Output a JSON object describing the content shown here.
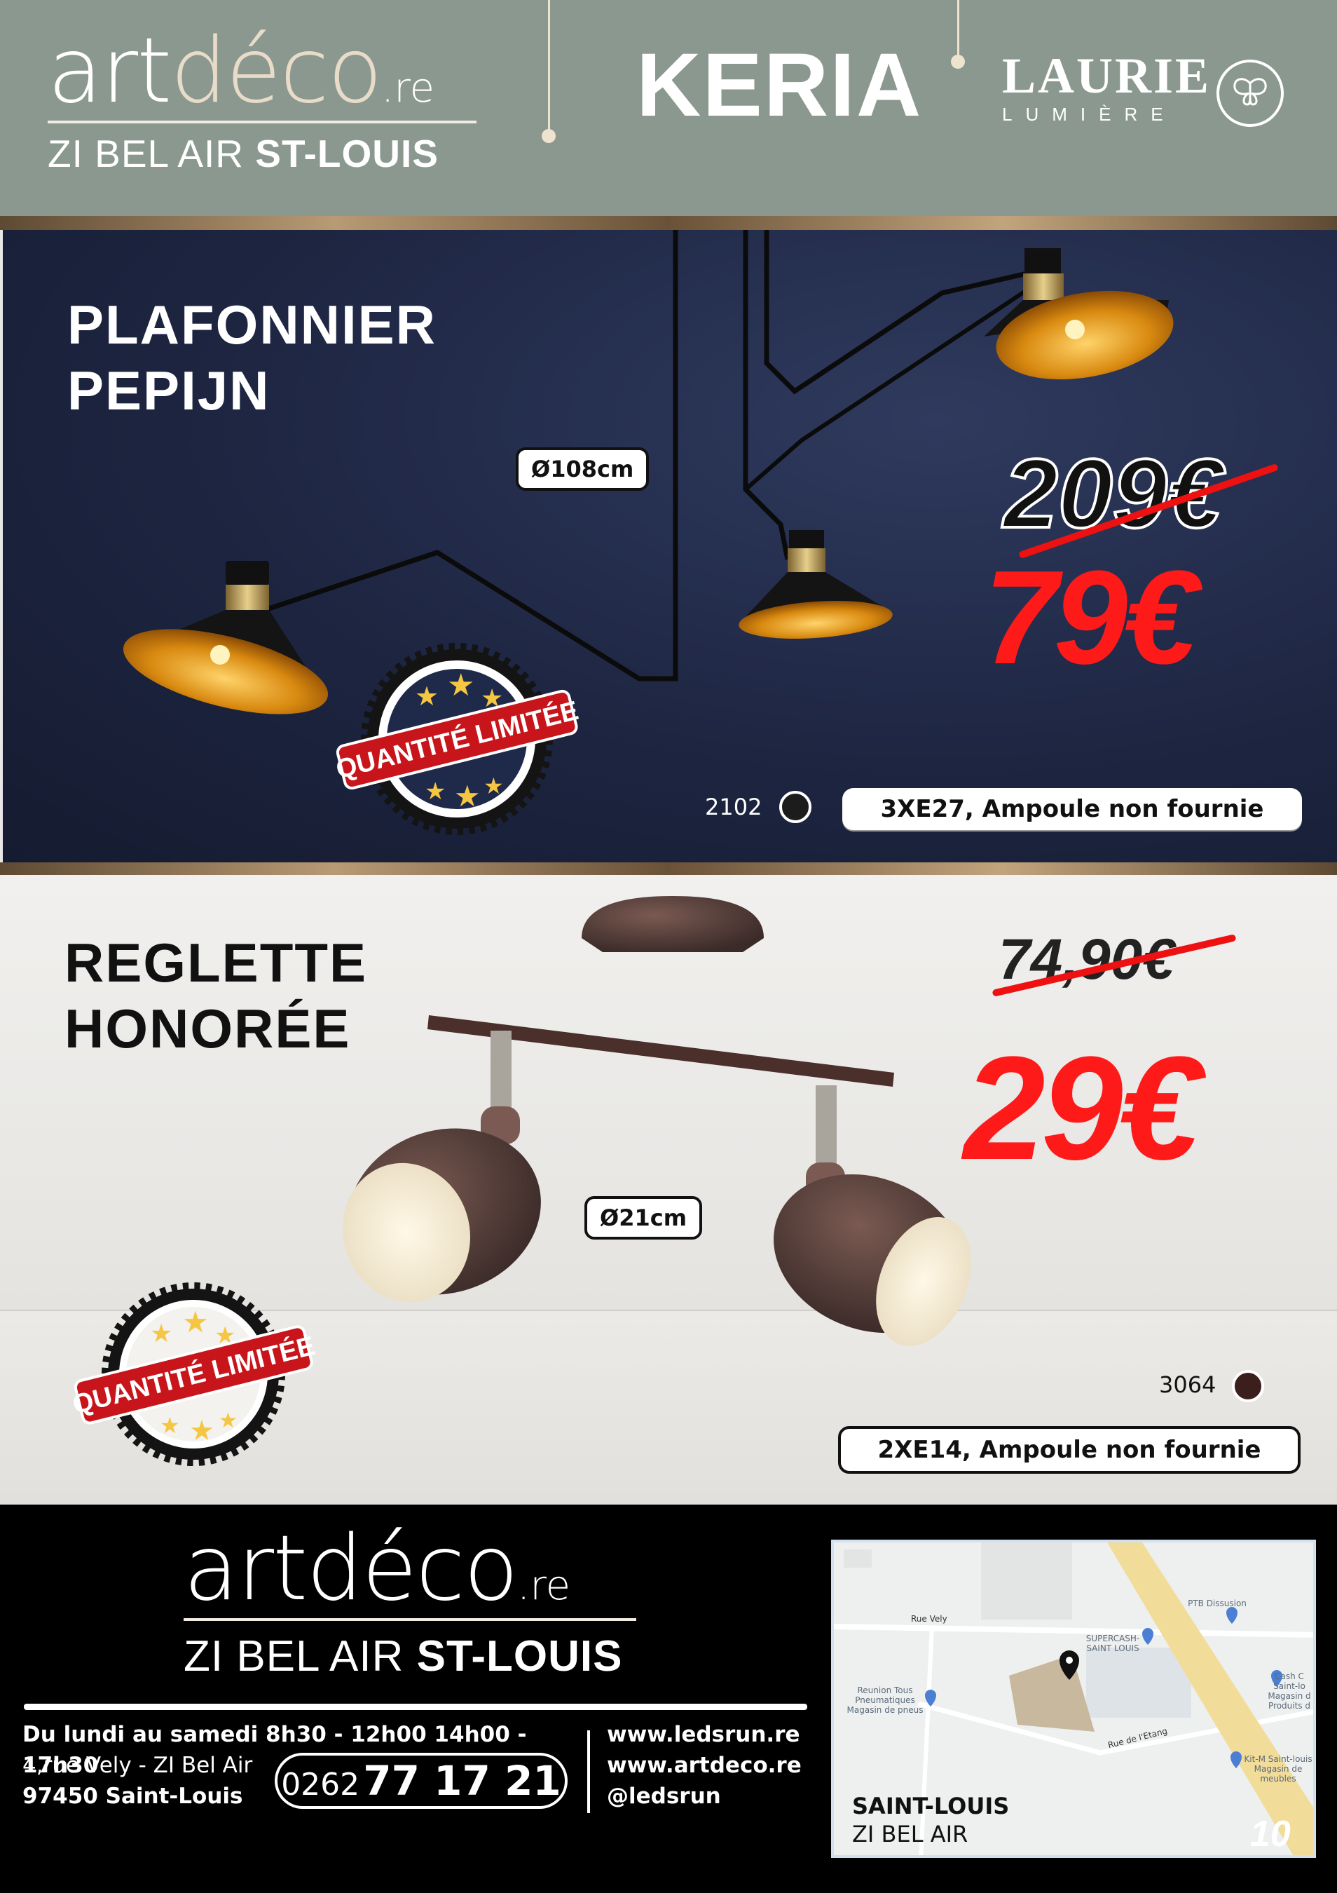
{
  "header": {
    "store_logo": {
      "art": "art",
      "deco": "déco",
      "re": ".re"
    },
    "store_location_prefix": "ZI BEL AIR ",
    "store_location_bold": "ST-LOUIS",
    "brand_1": "KERIA",
    "brand_2_name": "LAURIE",
    "brand_2_sub": "LUMIÈRE",
    "brand_2_icon": "butterfly-icon"
  },
  "products": [
    {
      "name_line1": "PLAFONNIER",
      "name_line2": "PEPIJN",
      "diameter": "Ø108cm",
      "old_price": "209€",
      "new_price": "79€",
      "badge": "QUANTITÉ LIMITÉE",
      "ref": "2102",
      "swatch_color": "#1c1c1c",
      "spec": "3XE27, Ampoule non fournie"
    },
    {
      "name_line1": "REGLETTE",
      "name_line2": "HONORÉE",
      "diameter": "Ø21cm",
      "old_price": "74,90€",
      "new_price": "29€",
      "badge": "QUANTITÉ LIMITÉE",
      "ref": "3064",
      "swatch_color": "#3a1f1c",
      "spec": "2XE14, Ampoule non fournie"
    }
  ],
  "footer": {
    "logo": {
      "art": "art",
      "deco": "déco",
      "re": ".re"
    },
    "location_prefix": "ZI BEL AIR ",
    "location_bold": "ST-LOUIS",
    "hours": "Du lundi au samedi 8h30 - 12h00 14h00 - 17h30",
    "address_line1": "4,rue Vely - ZI Bel Air",
    "address_line2": "97450 Saint-Louis",
    "phone_prefix": "0262",
    "phone_number": "77 17 21",
    "web_1": "www.ledsrun.re",
    "web_2": "www.artdeco.re",
    "social": "@ledsrun",
    "map": {
      "city": "SAINT-LOUIS",
      "area": "ZI BEL AIR",
      "street_1": "Rue Vely",
      "street_2": "Rue de l'Etang",
      "poi_1": "PTB Dissusion",
      "poi_2": "SUPERCASH- SAINT LOUIS",
      "poi_3": "Reunion Tous Pneumatiques Magasin de pneus",
      "poi_4": "Cash C Saint-lo Magasin d Produits d",
      "poi_5": "Kit-M Saint-louis Magasin de meubles"
    }
  },
  "page_number": "10"
}
